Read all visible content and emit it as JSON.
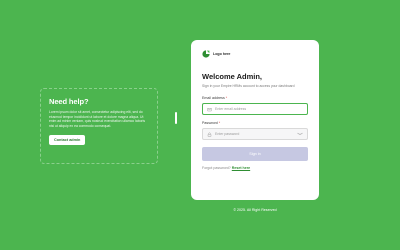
{
  "help": {
    "title": "Need help?",
    "text": "Lorem ipsum dolor sit amet, consectetur adipiscing elit, sed do eiusmod tempor incididunt ut labore et dolore magna aliqua. Ut enim ad minim veniam, quis nostrud exercitation ullamco laboris nisi ut aliquip ex ea commodo consequat.",
    "contact_label": "Contact admin"
  },
  "login": {
    "logo_text": "Logo here",
    "welcome": "Welcome Admin,",
    "subtitle": "Sign in your Empire HRMs account to access your dashboard",
    "email_label": "Email address",
    "email_placeholder": "Enter email address",
    "password_label": "Password",
    "password_placeholder": "Enter password",
    "required_mark": "*",
    "signin_label": "Sign in",
    "forgot_text": "Forgot password?",
    "reset_label": "Reset here"
  },
  "footer": {
    "copyright": "© 2025. All Right Reserved"
  },
  "colors": {
    "background": "#4cb54f",
    "accent": "#2f8e33",
    "button_disabled": "#c6c8e2"
  },
  "icons": [
    "logo-icon",
    "mail-icon",
    "lock-icon",
    "eye-off-icon"
  ]
}
